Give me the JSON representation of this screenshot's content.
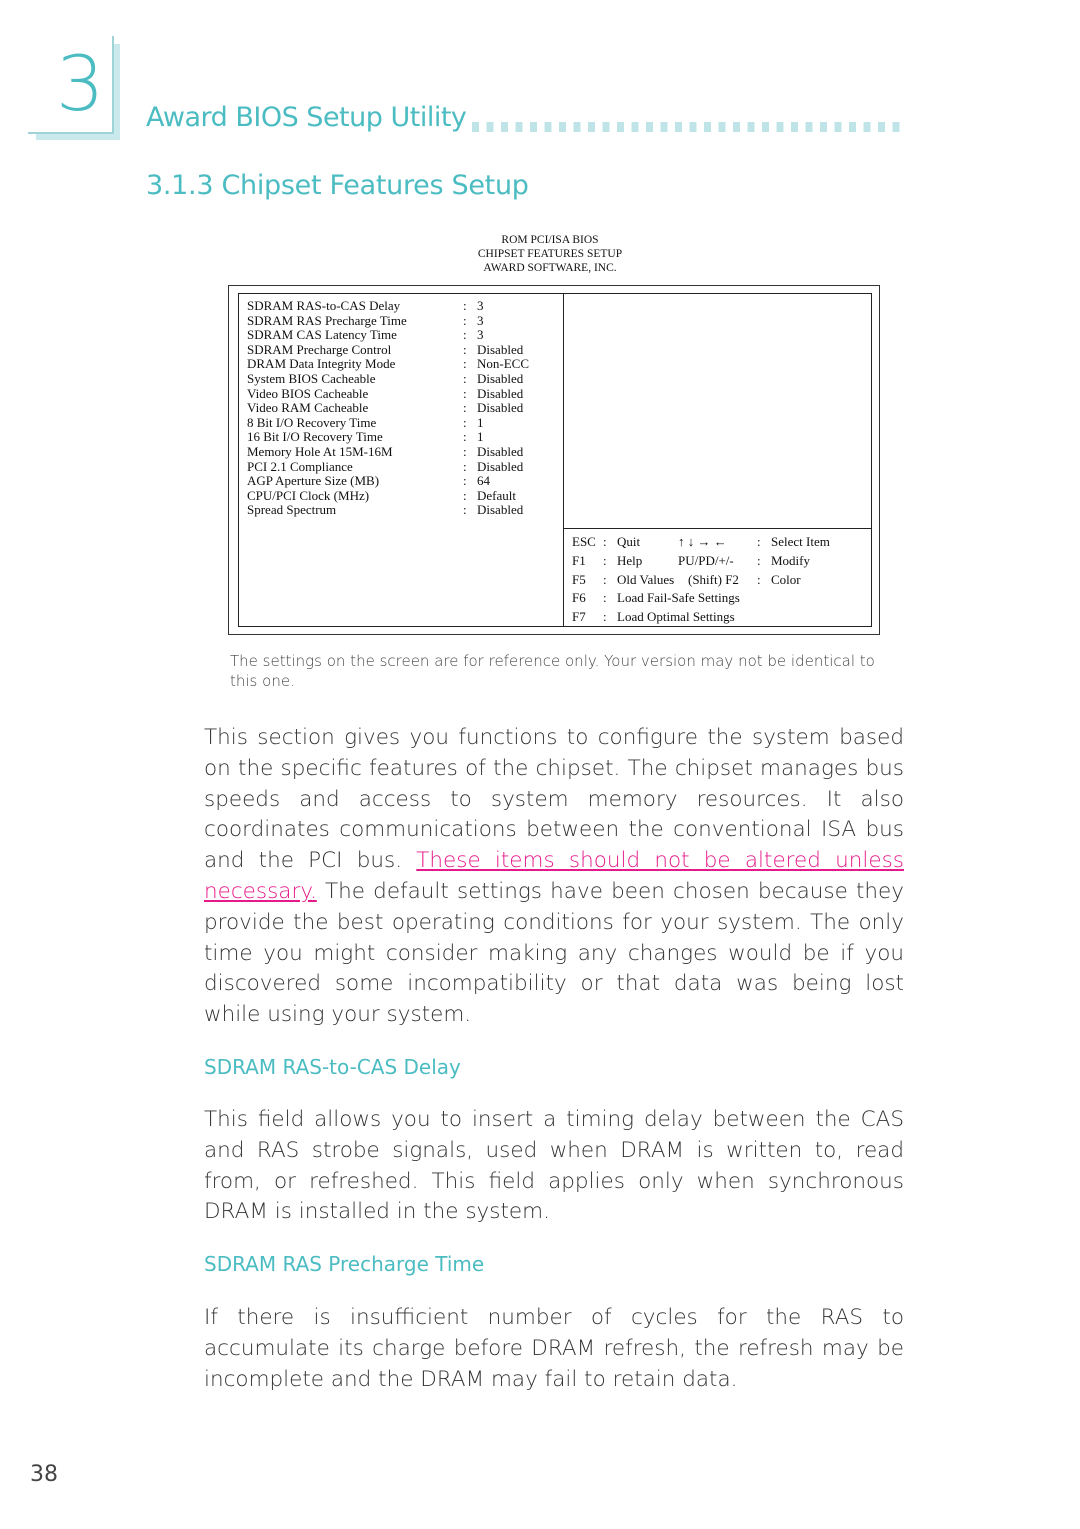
{
  "chapter": {
    "number": "3",
    "title": "Award BIOS Setup Utility"
  },
  "section": {
    "title": "3.1.3  Chipset Features Setup"
  },
  "bios_screen": {
    "header": [
      "ROM PCI/ISA BIOS",
      "CHIPSET FEATURES SETUP",
      "AWARD SOFTWARE, INC."
    ],
    "items": [
      {
        "label": "SDRAM RAS-to-CAS Delay",
        "value": "3"
      },
      {
        "label": "SDRAM RAS Precharge Time",
        "value": "3"
      },
      {
        "label": "SDRAM CAS Latency Time",
        "value": "3"
      },
      {
        "label": "SDRAM Precharge Control",
        "value": "Disabled"
      },
      {
        "label": "DRAM Data Integrity Mode",
        "value": "Non-ECC"
      },
      {
        "label": "System BIOS Cacheable",
        "value": "Disabled"
      },
      {
        "label": "Video BIOS Cacheable",
        "value": "Disabled"
      },
      {
        "label": "Video RAM Cacheable",
        "value": "Disabled"
      },
      {
        "label": "8 Bit I/O Recovery Time",
        "value": "1"
      },
      {
        "label": "16 Bit I/O Recovery Time",
        "value": "1"
      },
      {
        "label": "Memory Hole At 15M-16M",
        "value": "Disabled"
      },
      {
        "label": "PCI 2.1 Compliance",
        "value": "Disabled"
      },
      {
        "label": "AGP Aperture Size (MB)",
        "value": "64"
      },
      {
        "label": "CPU/PCI Clock (MHz)",
        "value": "Default"
      },
      {
        "label": "Spread Spectrum",
        "value": "Disabled"
      }
    ],
    "separator": ":",
    "keys": [
      {
        "key": "ESC",
        "action": "Quit",
        "key2": "↑ ↓ → ←",
        "action2": "Select Item"
      },
      {
        "key": "F1",
        "action": "Help",
        "key2": "PU/PD/+/-",
        "action2": "Modify"
      },
      {
        "key": "F5",
        "action": "Old Values",
        "key2": "(Shift) F2",
        "action2": "Color"
      },
      {
        "key": "F6",
        "action": "Load Fail-Safe Settings"
      },
      {
        "key": "F7",
        "action": "Load Optimal Settings"
      }
    ]
  },
  "caption": "The settings on the screen are for reference only. Your version may not be identical to this one.",
  "intro": {
    "before": "This section gives you functions to configure the system based on the specific features of the chipset. The chipset manages bus speeds and access to system memory resources. It also coordinates communications between the conventional ISA bus and the PCI bus. ",
    "warning": "These items should not be altered unless necessary.",
    "after": " The default settings have been chosen because they provide the best operating conditions for your system. The only time you might consider making any changes would be if you discovered some incompatibility or that data was being lost while using your system."
  },
  "subsections": [
    {
      "heading": "SDRAM RAS-to-CAS Delay",
      "text": "This field allows you to insert a timing delay between the CAS and RAS strobe signals, used when DRAM is written to, read from, or refreshed.  This field applies only when synchronous DRAM is installed in the system."
    },
    {
      "heading": "SDRAM RAS Precharge Time",
      "text": "If there is insufficient number of cycles for the RAS to accumulate its charge before DRAM refresh, the refresh may be incomplete and the DRAM may fail to retain data."
    }
  ],
  "page_number": "38",
  "colors": {
    "accent": "#4bbcc2",
    "warning": "#e6198a",
    "dots": "#bfe4e8"
  }
}
